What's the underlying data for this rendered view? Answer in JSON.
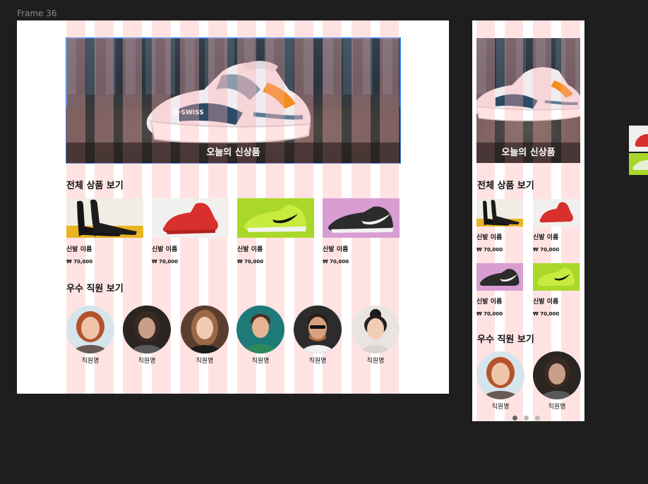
{
  "canvas": {
    "frame_label": "Frame 36"
  },
  "banner": {
    "caption": "오늘의 신상품"
  },
  "products_section": {
    "title": "전체 상품 보기",
    "items": [
      {
        "name": "신발 이름",
        "price": "₩ 70,000",
        "image": "black-heels"
      },
      {
        "name": "신발 이름",
        "price": "₩ 70,000",
        "image": "red-sneaker"
      },
      {
        "name": "신발 이름",
        "price": "₩ 70,000",
        "image": "lime-nike"
      },
      {
        "name": "신발 이름",
        "price": "₩ 70,000",
        "image": "black-nike-on-pink"
      }
    ]
  },
  "employees_section": {
    "title": "우수 직원 보기",
    "items": [
      {
        "name": "직원명"
      },
      {
        "name": "직원명"
      },
      {
        "name": "직원명"
      },
      {
        "name": "직원명"
      },
      {
        "name": "직원명"
      },
      {
        "name": "직원명"
      }
    ]
  },
  "mobile": {
    "banner_caption": "오늘의 신상품",
    "products_title": "전체 상품 보기",
    "products": [
      {
        "name": "신발 이름",
        "price": "₩ 70,000",
        "image": "black-heels"
      },
      {
        "name": "신발 이름",
        "price": "₩ 70,000",
        "image": "red-sneaker"
      },
      {
        "name": "신발 이름",
        "price": "₩ 70,000",
        "image": "black-nike-on-pink"
      },
      {
        "name": "신발 이름",
        "price": "₩ 70,000",
        "image": "lime-nike"
      }
    ],
    "employees_title": "우수 직원 보기",
    "employees": [
      {
        "name": "직원명"
      },
      {
        "name": "직원명"
      }
    ],
    "pager": {
      "pages": 3,
      "current": 1
    }
  },
  "colors": {
    "canvas_bg": "#1e1e1e",
    "frame_bg": "#ffffff",
    "grid_overlay": "#ffb0b0",
    "selection": "#3a86f0"
  }
}
